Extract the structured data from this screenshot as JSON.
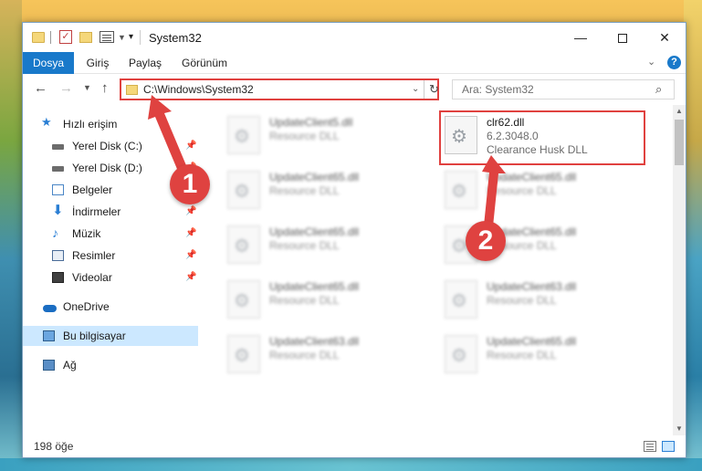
{
  "window": {
    "title": "System32"
  },
  "ribbon": {
    "tabs": [
      "Dosya",
      "Giriş",
      "Paylaş",
      "Görünüm"
    ]
  },
  "address": {
    "path": "C:\\Windows\\System32"
  },
  "search": {
    "placeholder": "Ara: System32"
  },
  "sidebar": {
    "items": [
      {
        "label": "Hızlı erişim",
        "icon": "star-icon",
        "pinned": false
      },
      {
        "label": "Yerel Disk (C:)",
        "icon": "drive-icon",
        "pinned": true
      },
      {
        "label": "Yerel Disk (D:)",
        "icon": "drive-icon",
        "pinned": true
      },
      {
        "label": "Belgeler",
        "icon": "documents-icon",
        "pinned": true
      },
      {
        "label": "İndirmeler",
        "icon": "downloads-icon",
        "pinned": true
      },
      {
        "label": "Müzik",
        "icon": "music-icon",
        "pinned": true
      },
      {
        "label": "Resimler",
        "icon": "pictures-icon",
        "pinned": true
      },
      {
        "label": "Videolar",
        "icon": "videos-icon",
        "pinned": true
      },
      {
        "label": "OneDrive",
        "icon": "cloud-icon",
        "pinned": false
      },
      {
        "label": "Bu bilgisayar",
        "icon": "computer-icon",
        "pinned": false,
        "selected": true
      },
      {
        "label": "Ağ",
        "icon": "network-icon",
        "pinned": false
      }
    ]
  },
  "files": {
    "highlighted": {
      "name": "clr62.dll",
      "version": "6.2.3048.0",
      "description": "Clearance Husk DLL"
    },
    "blurred_left": [
      {
        "name": "UpdateClient5.dll",
        "type": "Resource DLL"
      },
      {
        "name": "UpdateClient65.dll",
        "type": "Resource DLL"
      },
      {
        "name": "UpdateClient65.dll",
        "type": "Resource DLL"
      },
      {
        "name": "UpdateClient65.dll",
        "type": "Resource DLL"
      },
      {
        "name": "UpdateClient63.dll",
        "type": "Resource DLL"
      }
    ],
    "blurred_right": [
      {
        "name": "UpdateClient65.dll",
        "type": "Resource DLL"
      },
      {
        "name": "UpdateClient65.dll",
        "type": "Resource DLL"
      },
      {
        "name": "UpdateClient63.dll",
        "type": "Resource DLL"
      },
      {
        "name": "UpdateClient65.dll",
        "type": "Resource DLL"
      }
    ]
  },
  "status": {
    "count": "198 öğe"
  },
  "annotations": {
    "step1": "1",
    "step2": "2"
  },
  "colors": {
    "accent": "#1979ca",
    "highlight_red": "#e0413f",
    "selection": "#cce8ff"
  }
}
